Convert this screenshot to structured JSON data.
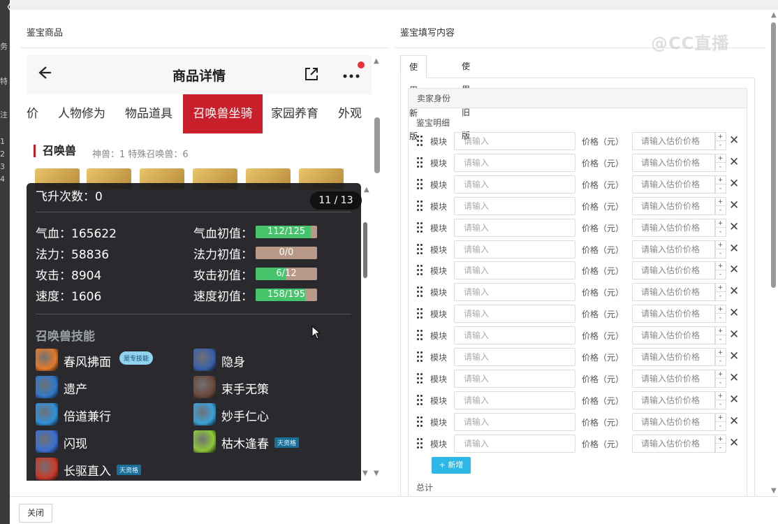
{
  "backdrop": {
    "glyphs": [
      "务",
      "特",
      "注",
      "1",
      "2",
      "3",
      "4"
    ],
    "close_glyph": "〈"
  },
  "left_panel": {
    "title": "鉴宝商品"
  },
  "right_panel": {
    "title": "鉴宝填写内容"
  },
  "watermark": "@CC直播",
  "phone": {
    "title": "商品详情",
    "category_tabs": [
      "价",
      "人物修为",
      "物品道具",
      "召唤兽坐骑",
      "家园养育",
      "外观"
    ],
    "active_tab_index": 3,
    "section_title": "召唤兽",
    "section_sub": "神兽：1   特殊召唤兽：6"
  },
  "overlay": {
    "fly_count": "飞升次数：0",
    "pager": "11 / 13",
    "stats_left": [
      {
        "label": "气血：",
        "value": "165622"
      },
      {
        "label": "法力：",
        "value": "58836"
      },
      {
        "label": "攻击：",
        "value": "8904"
      },
      {
        "label": "速度：",
        "value": "1606"
      }
    ],
    "stats_right": [
      {
        "label": "气血初值：",
        "text": "112/125",
        "fraction": 0.896
      },
      {
        "label": "法力初值：",
        "text": "0/0",
        "fraction": 0
      },
      {
        "label": "攻击初值：",
        "text": "6/12",
        "fraction": 0.5
      },
      {
        "label": "速度初值：",
        "text": "158/195",
        "fraction": 0.81
      }
    ],
    "skills_title": "召唤兽技能",
    "skills": [
      {
        "name": "春风拂面",
        "badge": "是专技能",
        "badge_style": "round",
        "color": "#e07a2a"
      },
      {
        "name": "隐身",
        "badge": "",
        "color": "#3a5fa8"
      },
      {
        "name": "遗产",
        "badge": "",
        "color": "#2f78c8"
      },
      {
        "name": "束手无策",
        "badge": "",
        "color": "#6a4a3a"
      },
      {
        "name": "倍道兼行",
        "badge": "",
        "color": "#2f8fd8"
      },
      {
        "name": "妙手仁心",
        "badge": "",
        "color": "#3aa0d8"
      },
      {
        "name": "闪现",
        "badge": "",
        "color": "#3b6fd0"
      },
      {
        "name": "枯木逢春",
        "badge": "天资格",
        "badge_style": "square",
        "color": "#8cc63a"
      },
      {
        "name": "长驱直入",
        "badge": "天资格",
        "badge_style": "square",
        "color": "#c83a2a"
      }
    ]
  },
  "form": {
    "tabs": [
      "使用新版",
      "使用旧版"
    ],
    "active_tab_index": 0,
    "seller_header": "卖家身份",
    "detail_label": "鉴宝明细",
    "row_labels": {
      "module": "模块",
      "module_placeholder": "请输入",
      "price": "价格（元）",
      "price_placeholder": "请输入估价价格",
      "spin_up": "+",
      "spin_down": "-",
      "remove": "✕"
    },
    "row_count": 15,
    "add_button": "+ 新增",
    "total_label": "总计"
  },
  "footer": {
    "close_button": "关闭"
  }
}
